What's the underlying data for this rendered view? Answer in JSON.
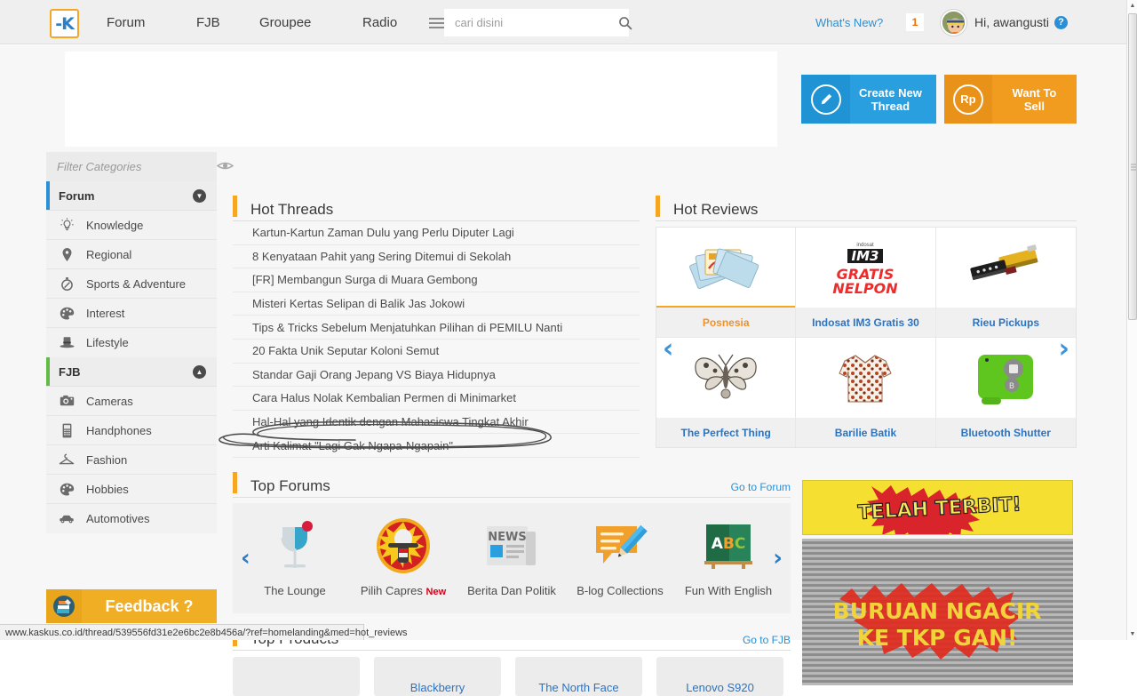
{
  "colors": {
    "brand_blue": "#2a8fd4",
    "brand_orange": "#f5a623",
    "green": "#62bb46",
    "link_blue": "#2a74c4",
    "red": "#d0021b"
  },
  "topbar": {
    "logo_text": "-K",
    "nav": [
      {
        "label": "Forum"
      },
      {
        "label": "FJB"
      },
      {
        "label": "Groupee"
      },
      {
        "label": "Radio"
      }
    ],
    "search": {
      "placeholder": "cari disini",
      "value": ""
    },
    "whats_new": "What's New?",
    "notification_count": "1",
    "greeting": "Hi, awangusti",
    "help_label": "?"
  },
  "actions": [
    {
      "id": "create-thread",
      "icon": "pencil-icon",
      "icon_text": "✎",
      "label": "Create New\nThread",
      "label_line1": "Create New",
      "label_line2": "Thread"
    },
    {
      "id": "want-to-sell",
      "icon": "rupiah-icon",
      "icon_text": "Rp",
      "label": "Want To Sell",
      "label_line1": "Want To Sell",
      "label_line2": ""
    }
  ],
  "sidebar": {
    "filter_placeholder": "Filter Categories",
    "filter_value": "",
    "eye_icon": "eye-icon",
    "groups": [
      {
        "title": "Forum",
        "accent": "#2a8fd4",
        "expanded": true,
        "chevron": "▼",
        "items": [
          {
            "label": "Knowledge",
            "icon": "lightbulb-icon"
          },
          {
            "label": "Regional",
            "icon": "map-pin-icon"
          },
          {
            "label": "Sports & Adventure",
            "icon": "compass-icon"
          },
          {
            "label": "Interest",
            "icon": "palette-icon"
          },
          {
            "label": "Lifestyle",
            "icon": "tophat-icon"
          }
        ]
      },
      {
        "title": "FJB",
        "accent": "#62bb46",
        "expanded": true,
        "chevron": "▲",
        "items": [
          {
            "label": "Cameras",
            "icon": "camera-icon"
          },
          {
            "label": "Handphones",
            "icon": "mobile-phone-icon"
          },
          {
            "label": "Fashion",
            "icon": "hanger-icon"
          },
          {
            "label": "Hobbies",
            "icon": "palette-icon"
          },
          {
            "label": "Automotives",
            "icon": "car-icon"
          }
        ]
      }
    ],
    "feedback_label": "Feedback ?"
  },
  "hot_threads": {
    "title": "Hot Threads",
    "items": [
      {
        "title": "Kartun-Kartun Zaman Dulu yang Perlu Diputer Lagi",
        "annotated": false
      },
      {
        "title": "8 Kenyataan Pahit yang Sering Ditemui di Sekolah",
        "annotated": false
      },
      {
        "title": "[FR] Membangun Surga di Muara Gembong",
        "annotated": false
      },
      {
        "title": "Misteri Kertas Selipan di Balik Jas Jokowi",
        "annotated": false
      },
      {
        "title": "Tips & Tricks Sebelum Menjatuhkan Pilihan di PEMILU Nanti",
        "annotated": false
      },
      {
        "title": "20 Fakta Unik Seputar Koloni Semut",
        "annotated": false
      },
      {
        "title": "Standar Gaji Orang Jepang VS Biaya Hidupnya",
        "annotated": false
      },
      {
        "title": "Cara Halus Nolak Kembalian Permen di Minimarket",
        "annotated": false
      },
      {
        "title": "Hal-Hal yang Identik dengan Mahasiswa Tingkat Akhir",
        "annotated": true
      },
      {
        "title": "Arti Kalimat \"Lagi Gak Ngapa-Ngapain\"",
        "annotated": false
      }
    ]
  },
  "hot_reviews": {
    "title": "Hot Reviews",
    "prev_label": "‹",
    "next_label": "›",
    "items": [
      {
        "label": "Posnesia",
        "image": "postcards-image",
        "active": true
      },
      {
        "label": "Indosat IM3 Gratis 30",
        "image": "im3-gratis-nelpon-logo",
        "active": false
      },
      {
        "label": "Rieu Pickups",
        "image": "guitar-pickup-image",
        "active": false
      },
      {
        "label": "The Perfect Thing",
        "image": "butterfly-brooch-image",
        "active": false
      },
      {
        "label": "Barilie Batik",
        "image": "batik-shirt-image",
        "active": false
      },
      {
        "label": "Bluetooth Shutter",
        "image": "green-bluetooth-remote-image",
        "active": false
      }
    ]
  },
  "top_forums": {
    "title": "Top Forums",
    "more_label": "Go to Forum",
    "prev_label": "‹",
    "next_label": "›",
    "items": [
      {
        "label": "The Lounge",
        "badge": "",
        "icon": "cocktail-glass-icon"
      },
      {
        "label": "Pilih Capres",
        "badge": "New",
        "icon": "microphone-icon"
      },
      {
        "label": "Berita Dan Politik",
        "badge": "",
        "icon": "newspaper-icon"
      },
      {
        "label": "B-log Collections",
        "badge": "",
        "icon": "speech-bubble-pencil-icon"
      },
      {
        "label": "Fun With English",
        "badge": "",
        "icon": "abc-blackboard-icon"
      }
    ]
  },
  "top_products": {
    "title": "Top Products",
    "more_label": "Go to FJB",
    "items": [
      {
        "label": ""
      },
      {
        "label": "Blackberry"
      },
      {
        "label": "The North Face"
      },
      {
        "label": "Lenovo S920"
      }
    ]
  },
  "ads": {
    "banner_top_label": "",
    "telah_terbit": "TELAH TERBIT!",
    "buruan_line1": "BURUAN NGACIR",
    "buruan_line2": "KE TKP GAN!"
  },
  "statusbar": {
    "url": "www.kaskus.co.id/thread/539556fd31e2e6bc2e8b456a/?ref=homelanding&med=hot_reviews"
  },
  "scrollbar": {
    "up_arrow": "▲",
    "down_arrow": "▼"
  }
}
